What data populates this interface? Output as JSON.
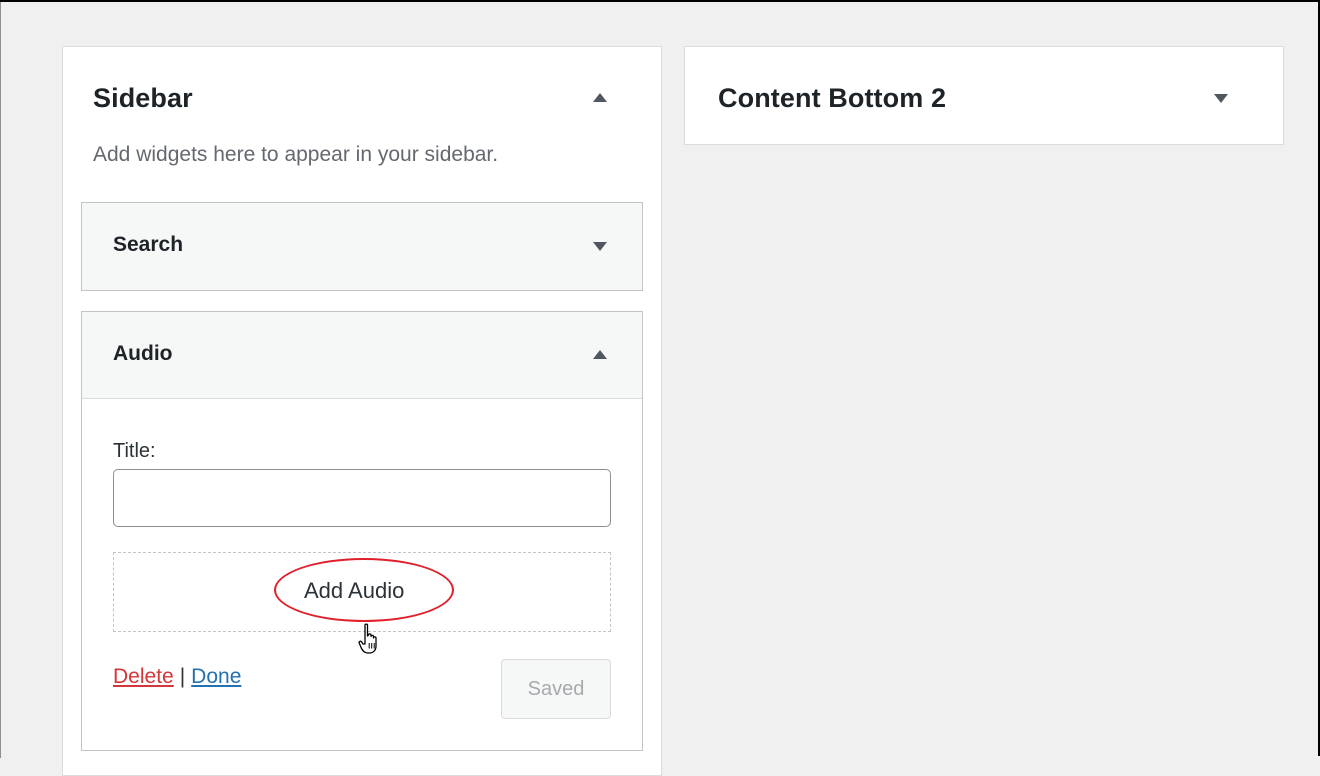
{
  "sidebar_area": {
    "title": "Sidebar",
    "description": "Add widgets here to appear in your sidebar.",
    "toggle_icon": "arrow-up-icon",
    "widgets": {
      "search": {
        "title": "Search",
        "toggle_icon": "arrow-down-icon"
      },
      "audio": {
        "title": "Audio",
        "toggle_icon": "arrow-up-icon",
        "title_label": "Title:",
        "title_value": "",
        "add_audio_label": "Add Audio",
        "delete_label": "Delete",
        "separator": "|",
        "done_label": "Done",
        "saved_label": "Saved"
      }
    }
  },
  "content_bottom_2": {
    "title": "Content Bottom 2",
    "toggle_icon": "arrow-down-icon"
  },
  "colors": {
    "highlight": "#e0202b",
    "delete": "#d63638",
    "done": "#2271b1"
  },
  "cursor_icon": "hand-pointer-icon"
}
